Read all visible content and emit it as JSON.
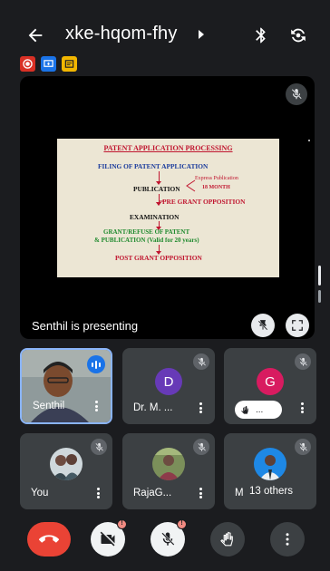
{
  "header": {
    "meeting_code": "xke-hqom-fhy"
  },
  "presentation": {
    "presenting_label": "Senthil is presenting",
    "slide": {
      "title": "PATENT APPLICATION PROCESSING",
      "step1": "FILING OF PATENT APPLICATION",
      "step2": "PUBLICATION",
      "step2_note_a": "Express Publication",
      "step2_note_b": "18 MONTH",
      "step3": "PRE GRANT OPPOSITION",
      "step4": "EXAMINATION",
      "step5_line1": "GRANT/REFUSE OF PATENT",
      "step5_line2": "& PUBLICATION (Valid for 20 years)",
      "step6": "POST GRANT OPPOSITION"
    }
  },
  "participants": [
    {
      "name": "Senthil",
      "type": "video",
      "speaking": true
    },
    {
      "name": "Dr. M. ...",
      "initial": "D",
      "color": "#673ab7"
    },
    {
      "name": "",
      "initial": "G",
      "color": "#d81b60",
      "raise_hand_label": "..."
    },
    {
      "name": "You",
      "type": "photo"
    },
    {
      "name": "RajaG...",
      "type": "photo"
    },
    {
      "name": "M",
      "type": "photo",
      "others_label": "13 others"
    }
  ],
  "controls": {
    "alert_badge": "!"
  },
  "colors": {
    "end_call": "#ea4335",
    "speaking_accent": "#1a73e8",
    "tile_bg": "#3c4043",
    "background": "#1b1c1f"
  }
}
